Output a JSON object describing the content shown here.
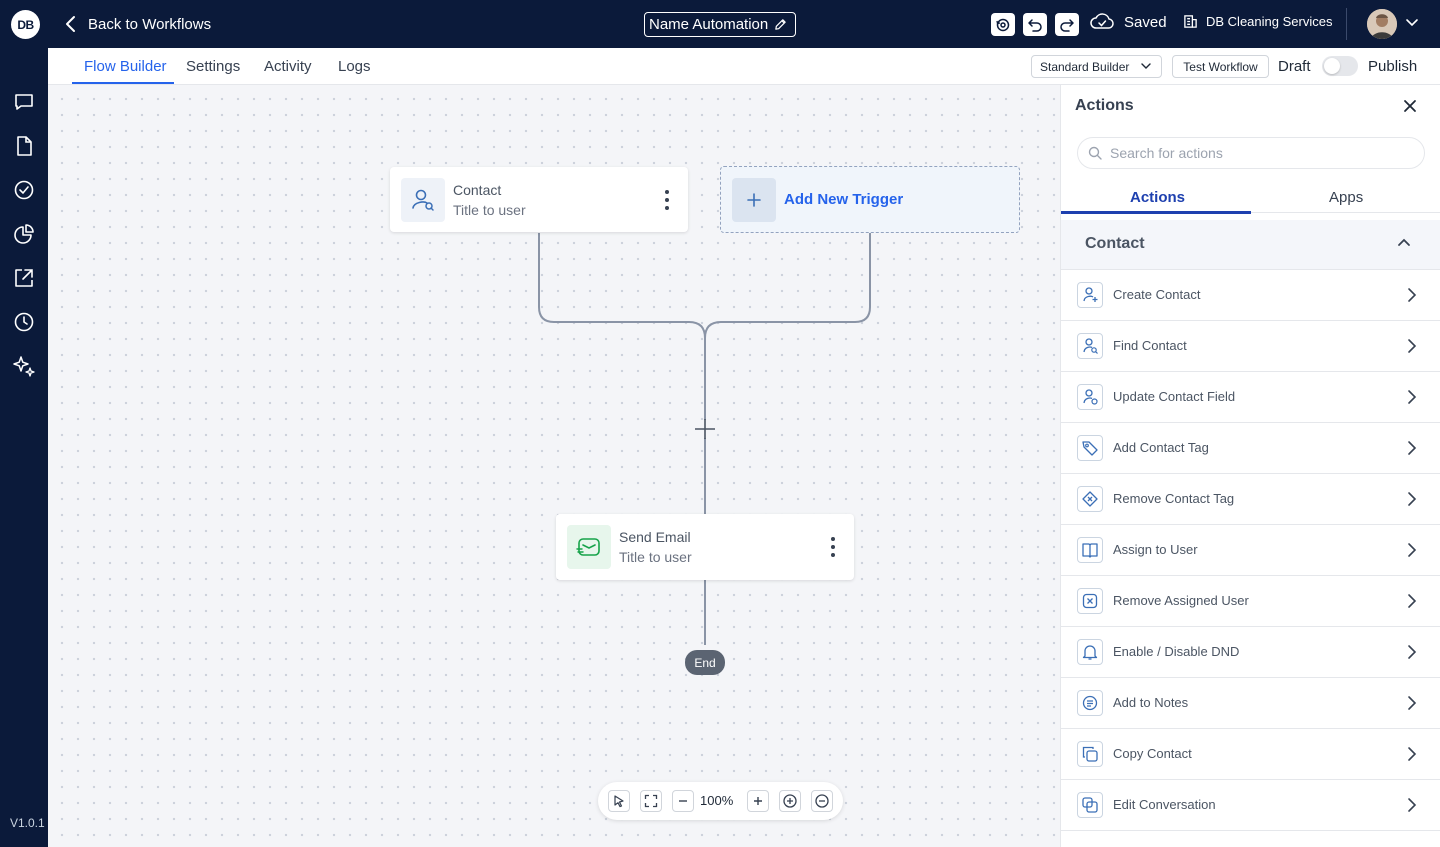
{
  "logo_text": "DB",
  "header": {
    "back_label": "Back to Workflows",
    "workflow_name": "Name Automation",
    "status": "Saved",
    "company": "DB Cleaning Services"
  },
  "version": "V1.0.1",
  "tabs": [
    "Flow Builder",
    "Settings",
    "Activity",
    "Logs"
  ],
  "toolbar": {
    "builder_select": "Standard Builder",
    "test_label": "Test Workflow",
    "draft_label": "Draft",
    "publish_label": "Publish"
  },
  "canvas": {
    "trigger_node": {
      "title": "Contact",
      "subtitle": "Title to user"
    },
    "add_trigger_label": "Add New Trigger",
    "email_node": {
      "title": "Send Email",
      "subtitle": "Title to user"
    },
    "end_label": "End",
    "zoom_level": "100%"
  },
  "panel": {
    "title": "Actions",
    "search_placeholder": "Search for actions",
    "tabs": [
      "Actions",
      "Apps"
    ],
    "section_title": "Contact",
    "actions": [
      {
        "label": "Create Contact",
        "icon": "user-plus-icon"
      },
      {
        "label": "Find Contact",
        "icon": "user-search-icon"
      },
      {
        "label": "Update Contact Field",
        "icon": "user-edit-icon"
      },
      {
        "label": "Add Contact Tag",
        "icon": "tag-icon"
      },
      {
        "label": "Remove Contact Tag",
        "icon": "tag-remove-icon"
      },
      {
        "label": "Assign to User",
        "icon": "book-open-icon"
      },
      {
        "label": "Remove Assigned User",
        "icon": "close-square-icon"
      },
      {
        "label": "Enable / Disable DND",
        "icon": "bell-icon"
      },
      {
        "label": "Add to Notes",
        "icon": "note-icon"
      },
      {
        "label": "Copy Contact",
        "icon": "copy-icon"
      },
      {
        "label": "Edit Conversation",
        "icon": "edit-conversation-icon"
      }
    ]
  },
  "colors": {
    "navy": "#0b1a3a",
    "accent_blue": "#2563eb",
    "email_green": "#16a34a"
  }
}
